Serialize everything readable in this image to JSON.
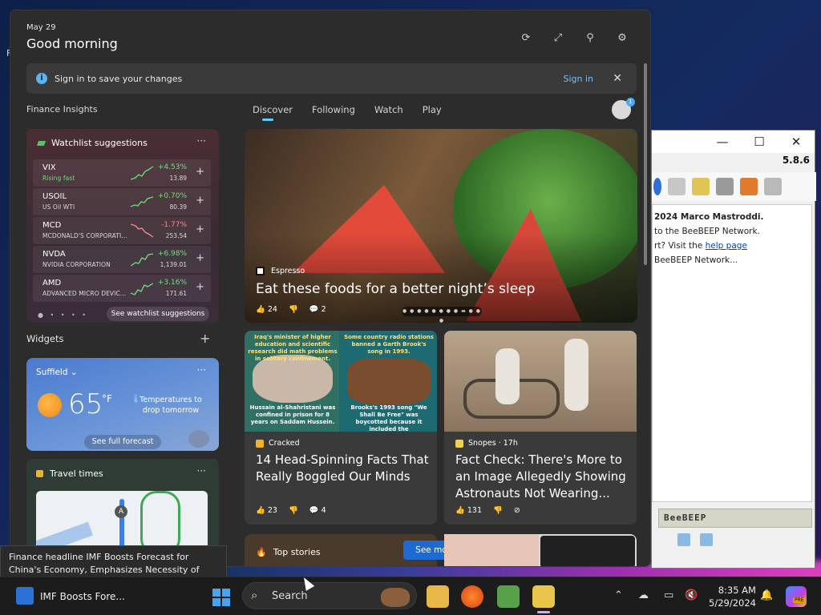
{
  "desktop": {
    "edge_letter": "F"
  },
  "background_app": {
    "titlebar": {
      "minimize": "—",
      "maximize": "☐",
      "close": "✕"
    },
    "version": "5.8.6",
    "body_lines": [
      "2024 Marco Mastroddi.",
      "to the BeeBEEP Network.",
      "rt? Visit the",
      "BeeBEEP Network..."
    ],
    "help_link": "help page",
    "banner": "BeeBEEP"
  },
  "panel": {
    "date": "May 29",
    "greeting": "Good morning",
    "signin_bar": {
      "text": "Sign in to save your changes",
      "action": "Sign in"
    },
    "finance_label": "Finance Insights",
    "tabs": [
      "Discover",
      "Following",
      "Watch",
      "Play"
    ],
    "active_tab": "Discover",
    "avatar_badge": "1"
  },
  "watchlist": {
    "title": "Watchlist suggestions",
    "items": [
      {
        "symbol": "VIX",
        "sub": "Rising fast",
        "change": "+4.53%",
        "price": "13.89",
        "color": "#6ee07c"
      },
      {
        "symbol": "USOIL",
        "sub": "US Oil WTI",
        "change": "+0.70%",
        "price": "80.39",
        "color": "#6ee07c"
      },
      {
        "symbol": "MCD",
        "sub": "MCDONALD'S CORPORATI...",
        "change": "-1.77%",
        "price": "253.54",
        "color": "#ff8a8a"
      },
      {
        "symbol": "NVDA",
        "sub": "NVIDIA CORPORATION",
        "change": "+6.98%",
        "price": "1,139.01",
        "color": "#6ee07c"
      },
      {
        "symbol": "AMD",
        "sub": "ADVANCED MICRO DEVIC...",
        "change": "+3.16%",
        "price": "171.61",
        "color": "#6ee07c"
      }
    ],
    "see_more": "See watchlist suggestions"
  },
  "widgets_label": "Widgets",
  "weather": {
    "city": "Suffield",
    "temp": "65",
    "unit": "°F",
    "note": "Temperatures to drop tomorrow",
    "forecast_btn": "See full forecast"
  },
  "travel": {
    "title": "Travel times",
    "pin": "A"
  },
  "hero": {
    "source": "Espresso",
    "title": "Eat these foods for a better night’s sleep",
    "likes": "24",
    "comments": "2"
  },
  "cards": [
    {
      "source": "Cracked",
      "title": "14 Head-Spinning Facts That Really Boggled Our Minds",
      "likes": "23",
      "comments": "4",
      "img_text_left": "Iraq's minister of higher education and scientific research did math problems in solitary confinement.",
      "img_text_right": "Some country radio stations banned a Garth Brook's song in 1993.",
      "img_caption_left": "Hussain al-Shahristani was confined in prison for 8 years on Saddam Hussein.",
      "img_caption_right": "Brooks's 1993 song \"We Shall Be Free\" was boycotted because it included the"
    },
    {
      "source": "Snopes · 17h",
      "title": "Fact Check: There's More to an Image Allegedly Showing Astronauts Not Wearing...",
      "likes": "131"
    }
  ],
  "top_stories": {
    "label": "Top stories",
    "see_more": "See more"
  },
  "tooltip": "Finance headline IMF Boosts Forecast for China's Economy, Emphasizes Necessity of Reforms for Sustained Growth",
  "taskbar": {
    "news_label": "IMF Boosts Fore...",
    "search_placeholder": "Search",
    "time": "8:35 AM",
    "date": "5/29/2024",
    "copilot_badge": "PRE"
  }
}
